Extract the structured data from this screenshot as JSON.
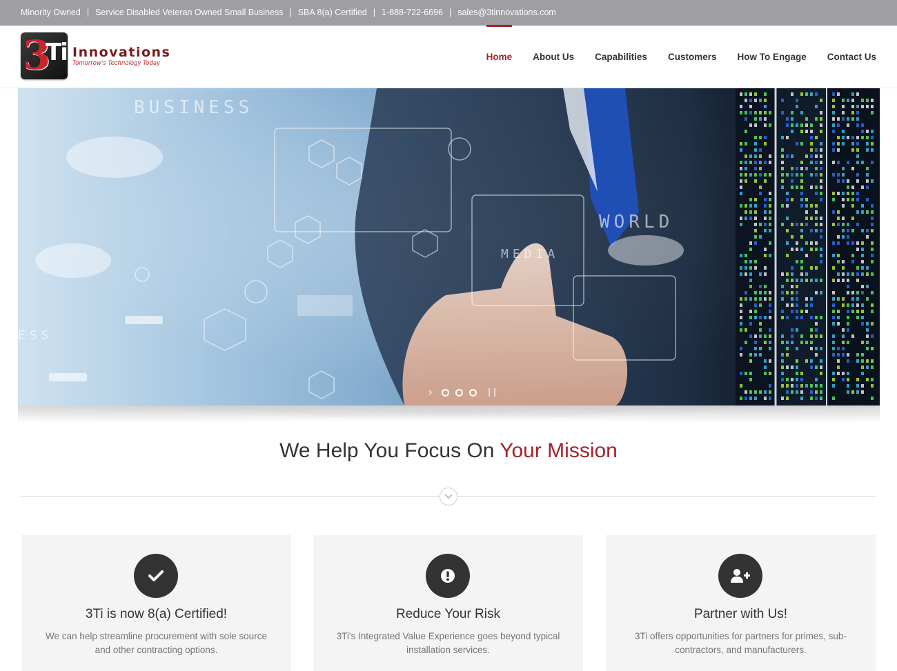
{
  "topbar": {
    "items": [
      "Minority Owned",
      "Service Disabled Veteran Owned Small Business",
      "SBA 8(a) Certified",
      "1-888-722-6696",
      "sales@3tinnovations.com"
    ]
  },
  "logo": {
    "mark": "3Ti",
    "name": "Innovations",
    "tagline": "Tomorrow's Technology Today"
  },
  "nav": {
    "items": [
      "Home",
      "About Us",
      "Capabilities",
      "Customers",
      "How To Engage",
      "Contact Us"
    ],
    "active": "Home"
  },
  "slider": {
    "labels": [
      "BUSINESS",
      "WORLD",
      "MEDIA",
      "ESS"
    ],
    "slide_count": 3,
    "current_slide": 1
  },
  "mission": {
    "lead": "We Help You Focus On ",
    "accent": "Your Mission"
  },
  "cards": [
    {
      "icon": "check-icon",
      "title": "3Ti is now 8(a) Certified!",
      "text": "We can help streamline procurement with sole source and other contracting options."
    },
    {
      "icon": "exclamation-icon",
      "title": "Reduce Your Risk",
      "text": "3Ti's Integrated Value Experience goes beyond typical installation services."
    },
    {
      "icon": "user-plus-icon",
      "title": "Partner with Us!",
      "text": "3Ti offers opportunities for partners for primes, sub-contractors, and manufacturers."
    }
  ],
  "colors": {
    "accent": "#a3232a",
    "topbar": "#9e9ea3",
    "card_bg": "#f4f4f4",
    "icon_circle": "#333333"
  }
}
